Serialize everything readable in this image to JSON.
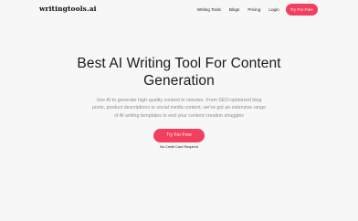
{
  "nav": {
    "logo": "writingtools.ai",
    "links": [
      "Writing Tools",
      "Blogs",
      "Pricing",
      "Login"
    ],
    "cta": "Try For Free"
  },
  "hero": {
    "title_line1": "Best AI Writing Tool For Content",
    "title_line2": "Generation",
    "subtitle": "Use AI to generate high-quality content in minutes. From SEO-optimized blog posts, product descriptions to social media content, we've got an extensive range of AI writing templates to end your content creation struggles",
    "cta": "Try For Free",
    "note": "No Credit Card Required"
  },
  "colors": {
    "accent": "#f33f5e",
    "background": "#f7f7f7"
  }
}
